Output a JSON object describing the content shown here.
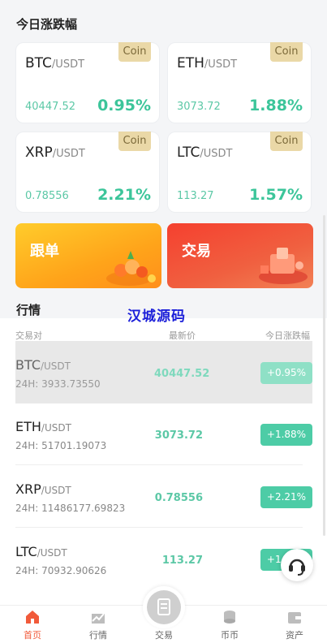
{
  "today_section": {
    "title": "今日涨跌幅"
  },
  "cards": [
    {
      "base": "BTC",
      "quote": "/USDT",
      "price": "40447.52",
      "change": "0.95%",
      "tag": "Coin"
    },
    {
      "base": "ETH",
      "quote": "/USDT",
      "price": "3073.72",
      "change": "1.88%",
      "tag": "Coin"
    },
    {
      "base": "XRP",
      "quote": "/USDT",
      "price": "0.78556",
      "change": "2.21%",
      "tag": "Coin"
    },
    {
      "base": "LTC",
      "quote": "/USDT",
      "price": "113.27",
      "change": "1.57%",
      "tag": "Coin"
    }
  ],
  "banners": {
    "follow": "跟单",
    "trade": "交易"
  },
  "market": {
    "title": "行情",
    "watermark": "汉城源码",
    "columns": {
      "pair": "交易对",
      "last": "最新价",
      "change": "今日涨跌幅"
    },
    "rows": [
      {
        "base": "BTC",
        "quote": "/USDT",
        "volume": "24H: 3933.73550",
        "last": "40447.52",
        "change": "+0.95%"
      },
      {
        "base": "ETH",
        "quote": "/USDT",
        "volume": "24H: 51701.19073",
        "last": "3073.72",
        "change": "+1.88%"
      },
      {
        "base": "XRP",
        "quote": "/USDT",
        "volume": "24H: 11486177.69823",
        "last": "0.78556",
        "change": "+2.21%"
      },
      {
        "base": "LTC",
        "quote": "/USDT",
        "volume": "24H: 70932.90626",
        "last": "113.27",
        "change": "+1.57%"
      }
    ]
  },
  "tabbar": [
    {
      "label": "首页",
      "icon": "home-icon",
      "active": true
    },
    {
      "label": "行情",
      "icon": "chart-icon",
      "active": false
    },
    {
      "label": "交易",
      "icon": "trade-icon",
      "active": false
    },
    {
      "label": "币币",
      "icon": "coins-icon",
      "active": false
    },
    {
      "label": "资产",
      "icon": "wallet-icon",
      "active": false
    }
  ],
  "colors": {
    "up": "#3cc59a",
    "accent": "#f15a3a",
    "tag_bg": "#ead8a7"
  }
}
